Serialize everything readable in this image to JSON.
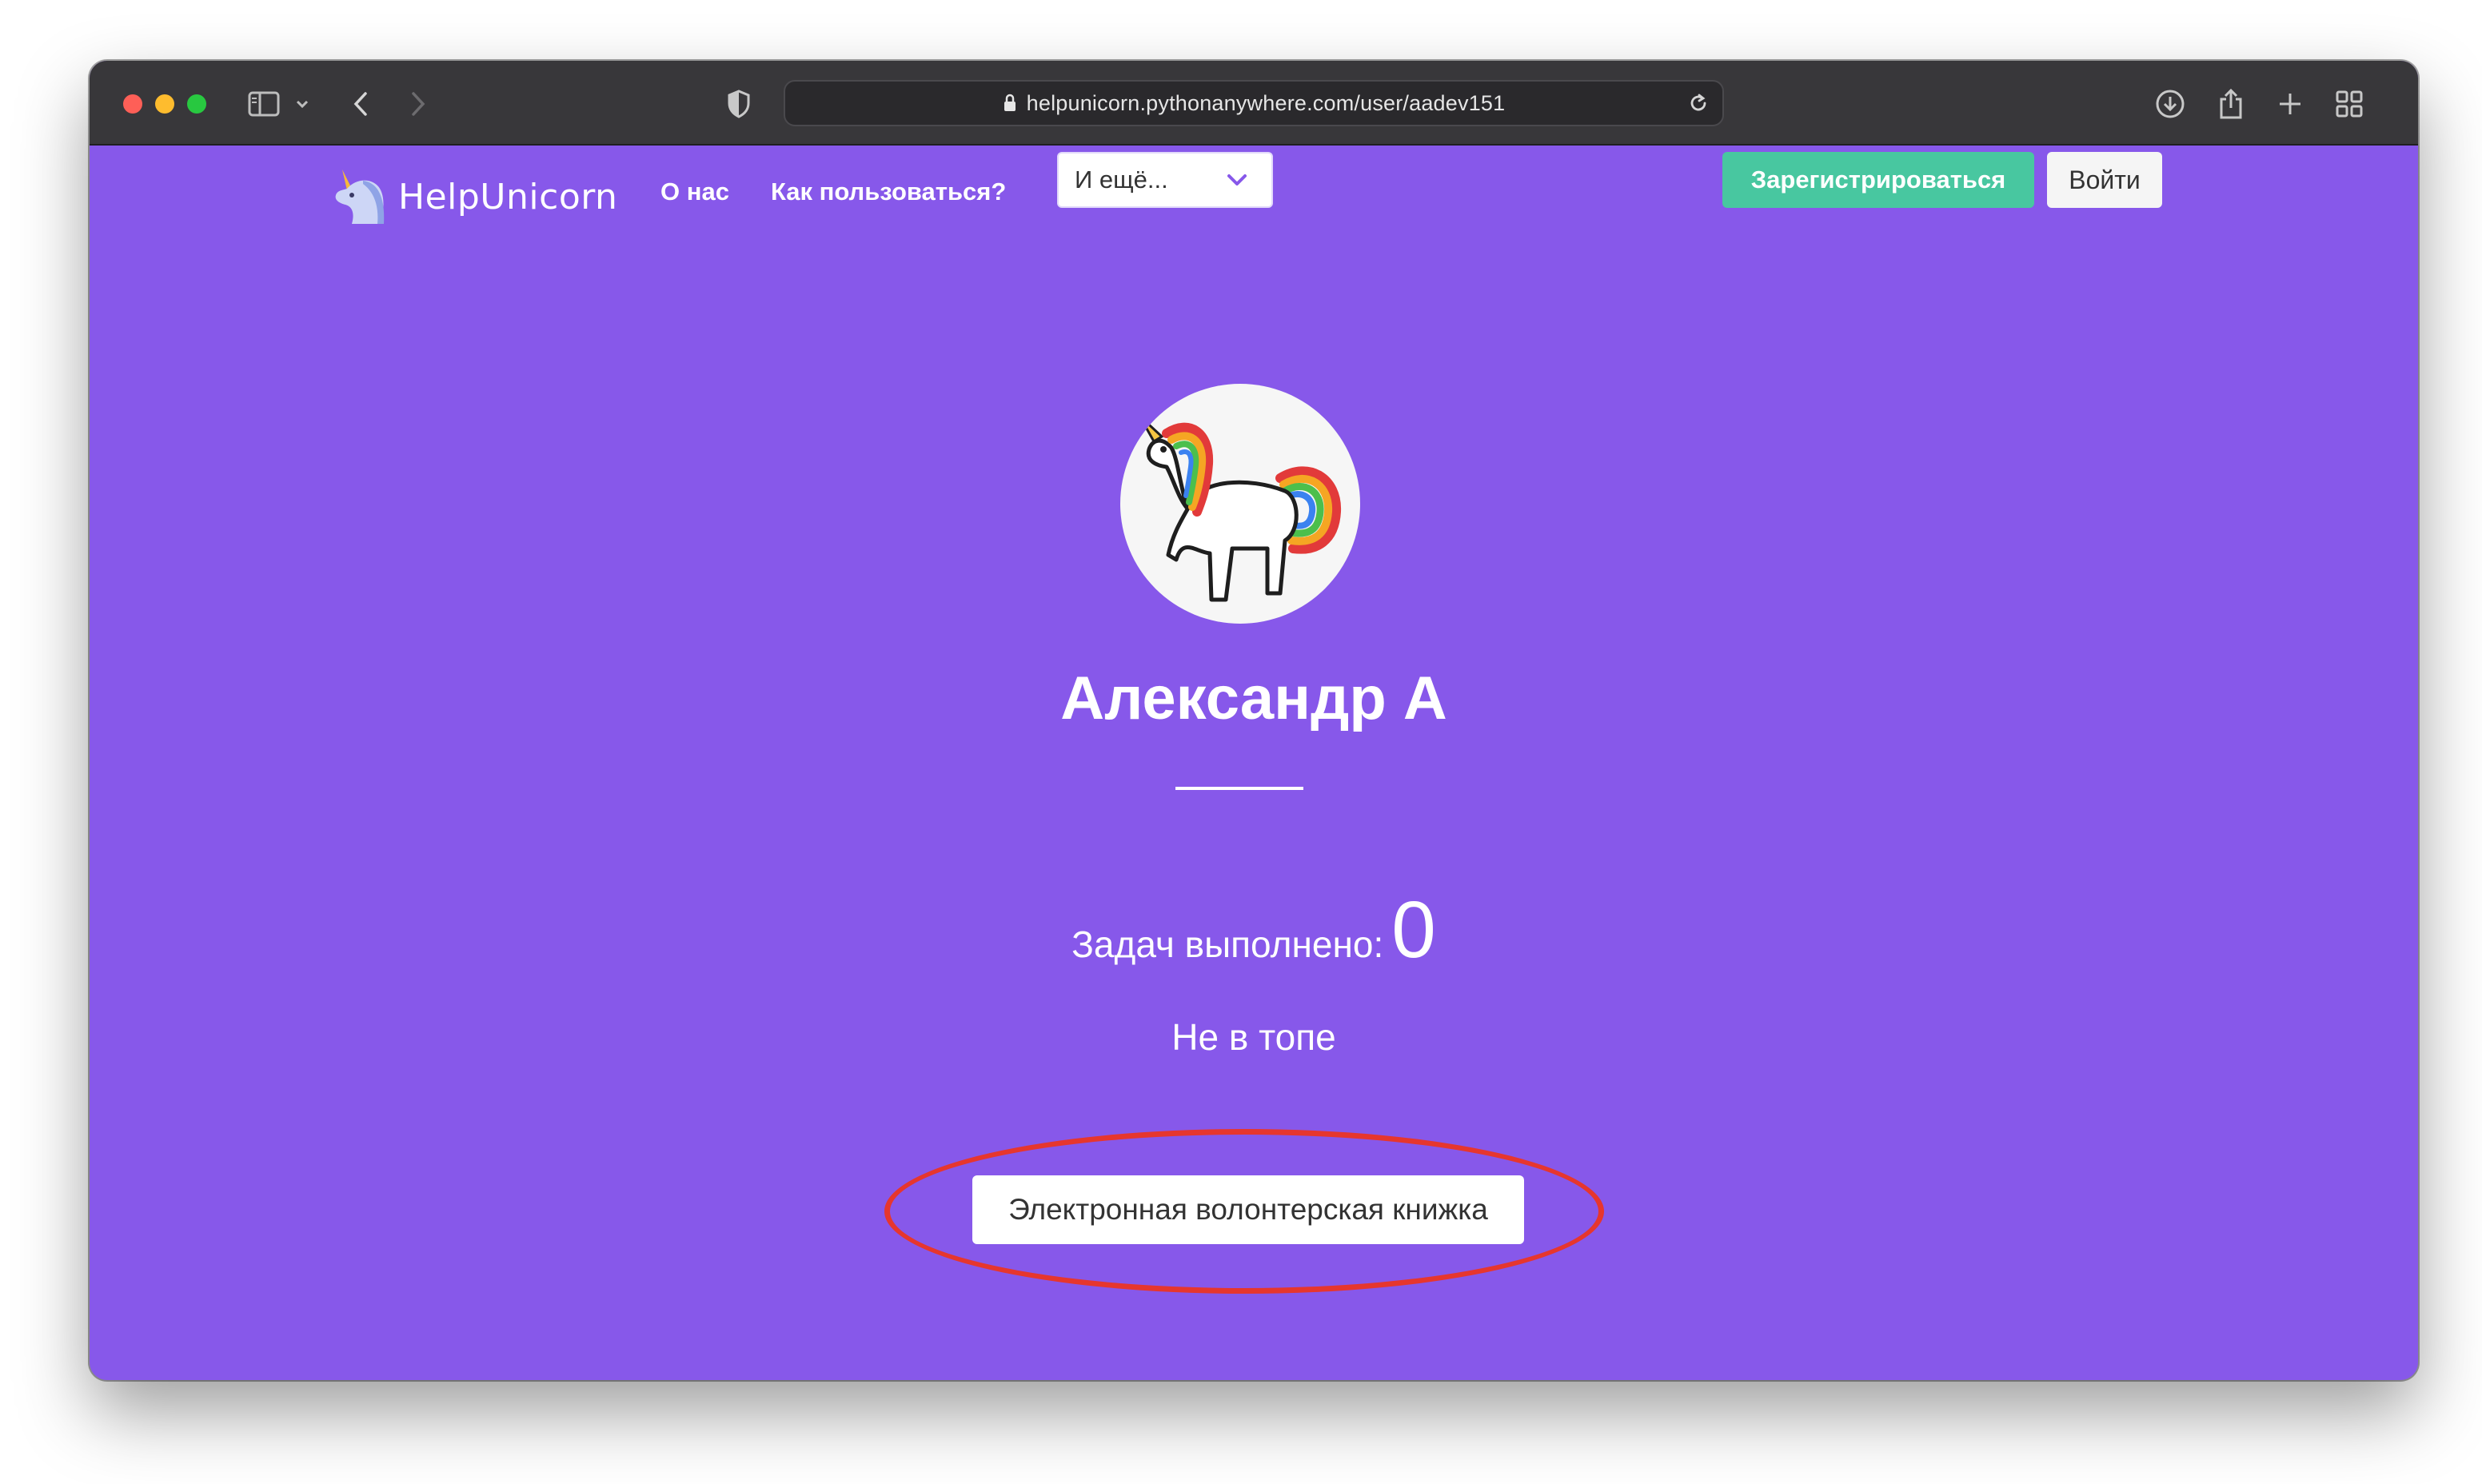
{
  "browser": {
    "url": "helpunicorn.pythonanywhere.com/user/aadev151",
    "icons": [
      "sidebar-icon",
      "chevron-down-icon",
      "back-icon",
      "forward-icon",
      "shield-icon",
      "lock-icon",
      "reload-icon",
      "download-icon",
      "share-icon",
      "new-tab-icon",
      "tab-overview-icon"
    ]
  },
  "nav": {
    "brand": "HelpUnicorn",
    "links": {
      "about": "О нас",
      "howto": "Как пользоваться?"
    },
    "dropdown": {
      "value": "И ещё..."
    },
    "register_label": "Зарегистрироваться",
    "login_label": "Войти"
  },
  "profile": {
    "name": "Александр А",
    "tasks_label": "Задач выполнено:",
    "tasks_count": "0",
    "rank": "Не в топе",
    "book_button": "Электронная волонтерская книжка"
  },
  "colors": {
    "page_bg": "#8758ea",
    "register_bg": "#48c7a0",
    "toolbar_bg": "#38373a",
    "highlight": "#e6362e"
  }
}
